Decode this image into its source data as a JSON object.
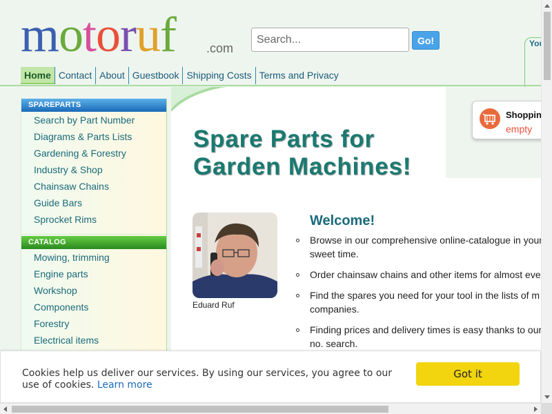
{
  "logo": {
    "letters": [
      "m",
      "o",
      "t",
      "o",
      "r",
      "u",
      "f"
    ],
    "dotcom": ".com"
  },
  "search": {
    "placeholder": "Search...",
    "button": "Go!"
  },
  "account": {
    "label": "You"
  },
  "nav": {
    "items": [
      {
        "label": "Home",
        "active": true
      },
      {
        "label": "Contact"
      },
      {
        "label": "About"
      },
      {
        "label": "Guestbook"
      },
      {
        "label": "Shipping Costs"
      },
      {
        "label": "Terms and Privacy"
      }
    ]
  },
  "sidebar": {
    "spareparts": {
      "heading": "SPAREPARTS",
      "items": [
        "Search by Part Number",
        "Diagrams & Parts Lists",
        "Gardening & Forestry",
        "Industry & Shop",
        "Chainsaw Chains",
        "Guide Bars",
        "Sprocket Rims"
      ]
    },
    "catalog": {
      "heading": "CATALOG",
      "items": [
        "Mowing, trimming",
        "Engine parts",
        "Workshop",
        "Components",
        "Forestry",
        "Electrical items"
      ]
    }
  },
  "cart": {
    "title": "Shoppin",
    "status": "empty",
    "icon": "shopping-cart-icon"
  },
  "hero": {
    "line1": "Spare Parts for",
    "line2": "Garden Machines!"
  },
  "photo": {
    "caption": "Eduard Ruf"
  },
  "welcome": {
    "title": "Welcome!",
    "items": [
      [
        "Browse in our comprehensive online-catalogue in your",
        "sweet time."
      ],
      [
        "Order chainsaw chains and other items for almost eve"
      ],
      [
        "Find the spares you need for your tool in the lists of m",
        "companies."
      ],
      [
        "Finding prices and delivery times is easy thanks to our",
        "no. search."
      ]
    ]
  },
  "cookie": {
    "text": "Cookies help us deliver our services. By using our services, you agree to our use of cookies.",
    "link": "Learn more",
    "button": "Got it"
  },
  "colors": {
    "accent_green": "#a8dba0",
    "title_teal": "#1a7a70",
    "cookie_button": "#f2d50f",
    "go_button": "#4aa3e8"
  }
}
